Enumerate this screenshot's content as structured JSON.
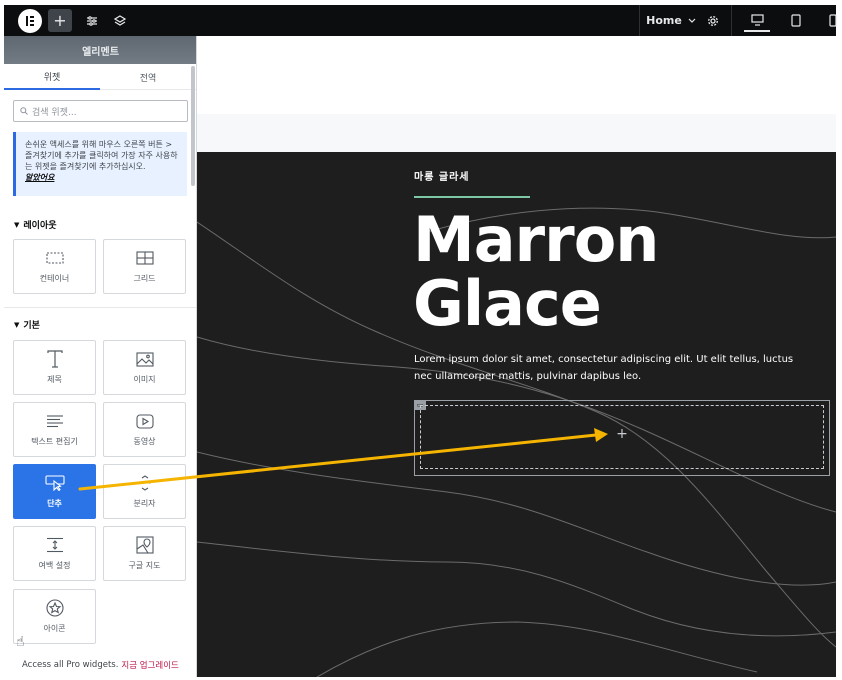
{
  "topbar": {
    "logo_icon": "elementor-logo-icon",
    "add_icon": "plus-icon",
    "settings_icon": "sliders-icon",
    "layers_icon": "layers-icon",
    "page_selector": "Home",
    "site_settings_icon": "gear-icon",
    "devices": [
      "desktop-icon",
      "tablet-icon",
      "mobile-icon"
    ],
    "active_device": "desktop"
  },
  "sidebar": {
    "title": "엘리멘트",
    "tabs": [
      {
        "label": "위젯",
        "active": true
      },
      {
        "label": "전역",
        "active": false
      }
    ],
    "search": {
      "placeholder": "검색 위젯..."
    },
    "notice": {
      "text": "손쉬운 액세스를 위해 마우스 오른쪽 버튼 > 즐겨찾기에 추가를 클릭하여 가장 자주 사용하는 위젯을 즐겨찾기에 추가하십시오.",
      "link": "알았어요"
    },
    "sections": [
      {
        "title": "레이아웃",
        "widgets": [
          {
            "label": "컨테이너",
            "icon": "container-icon"
          },
          {
            "label": "그리드",
            "icon": "grid-icon"
          }
        ]
      },
      {
        "title": "기본",
        "widgets": [
          {
            "label": "제목",
            "icon": "heading-icon"
          },
          {
            "label": "이미지",
            "icon": "image-icon"
          },
          {
            "label": "텍스트 편집기",
            "icon": "text-editor-icon"
          },
          {
            "label": "동영상",
            "icon": "video-icon"
          },
          {
            "label": "단추",
            "icon": "button-icon",
            "active": true
          },
          {
            "label": "분리자",
            "icon": "divider-icon"
          },
          {
            "label": "여백 설정",
            "icon": "spacer-icon"
          },
          {
            "label": "구글 지도",
            "icon": "map-icon"
          },
          {
            "label": "아이콘",
            "icon": "star-icon"
          }
        ]
      }
    ],
    "footer": {
      "text": "Access all Pro widgets.",
      "link": "지금 업그레이드"
    }
  },
  "canvas": {
    "eyebrow": "마롱 글라세",
    "title_line1": "Marron",
    "title_line2": "Glace",
    "body": "Lorem ipsum dolor sit amet, consectetur adipiscing elit. Ut elit tellus, luctus nec ullamcorper mattis, pulvinar dapibus leo.",
    "drop_zone_icon": "plus-icon",
    "colors": {
      "dark_bg": "#1e1e1e",
      "accent_green": "#7cc7a4",
      "active_blue": "#2b74e8",
      "arrow": "#f5b400"
    }
  }
}
